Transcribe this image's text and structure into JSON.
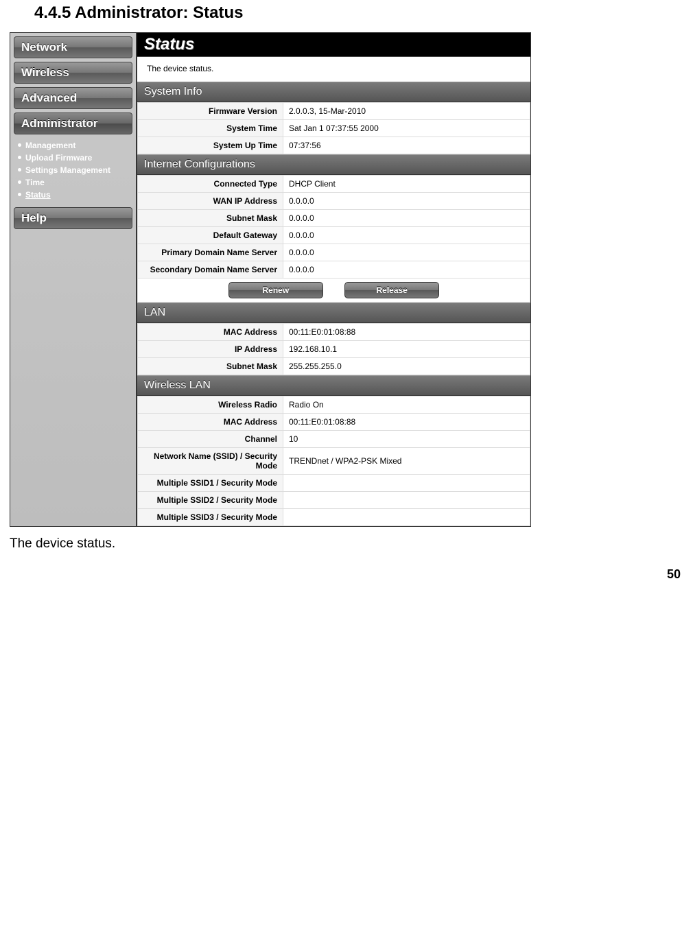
{
  "doc": {
    "heading": "4.4.5 Administrator: Status",
    "caption": "The device status.",
    "page_number": "50"
  },
  "sidebar": {
    "items": [
      {
        "label": "Network"
      },
      {
        "label": "Wireless"
      },
      {
        "label": "Advanced"
      },
      {
        "label": "Administrator"
      }
    ],
    "subitems": [
      {
        "label": "Management"
      },
      {
        "label": "Upload Firmware"
      },
      {
        "label": "Settings Management"
      },
      {
        "label": "Time"
      },
      {
        "label": "Status"
      }
    ],
    "help": "Help"
  },
  "content": {
    "title": "Status",
    "subtitle": "The device status.",
    "buttons": {
      "renew": "Renew",
      "release": "Release"
    },
    "sections": {
      "sysinfo": {
        "head": "System Info",
        "rows": [
          {
            "label": "Firmware Version",
            "value": "2.0.0.3, 15-Mar-2010"
          },
          {
            "label": "System Time",
            "value": "Sat Jan 1 07:37:55 2000"
          },
          {
            "label": "System Up Time",
            "value": "07:37:56"
          }
        ]
      },
      "inet": {
        "head": "Internet Configurations",
        "rows": [
          {
            "label": "Connected Type",
            "value": "DHCP Client"
          },
          {
            "label": "WAN IP Address",
            "value": "0.0.0.0"
          },
          {
            "label": "Subnet Mask",
            "value": "0.0.0.0"
          },
          {
            "label": "Default Gateway",
            "value": "0.0.0.0"
          },
          {
            "label": "Primary Domain Name Server",
            "value": "0.0.0.0"
          },
          {
            "label": "Secondary Domain Name Server",
            "value": "0.0.0.0"
          }
        ]
      },
      "lan": {
        "head": "LAN",
        "rows": [
          {
            "label": "MAC Address",
            "value": "00:11:E0:01:08:88"
          },
          {
            "label": "IP Address",
            "value": "192.168.10.1"
          },
          {
            "label": "Subnet Mask",
            "value": "255.255.255.0"
          }
        ]
      },
      "wlan": {
        "head": "Wireless LAN",
        "rows": [
          {
            "label": "Wireless Radio",
            "value": "Radio On"
          },
          {
            "label": "MAC Address",
            "value": "00:11:E0:01:08:88"
          },
          {
            "label": "Channel",
            "value": "10"
          },
          {
            "label": "Network Name (SSID) / Security Mode",
            "value": "TRENDnet / WPA2-PSK Mixed"
          },
          {
            "label": "Multiple SSID1 / Security Mode",
            "value": ""
          },
          {
            "label": "Multiple SSID2 / Security Mode",
            "value": ""
          },
          {
            "label": "Multiple SSID3 / Security Mode",
            "value": ""
          }
        ]
      }
    }
  }
}
